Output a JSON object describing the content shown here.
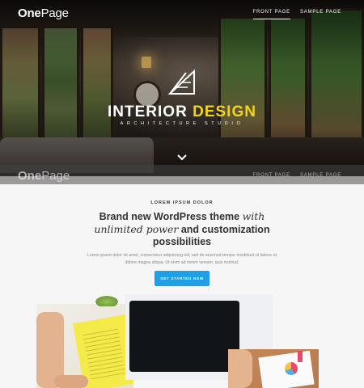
{
  "site": {
    "logo_bold": "One",
    "logo_light": "Page"
  },
  "nav": {
    "items": [
      {
        "label": "FRONT PAGE",
        "active": true
      },
      {
        "label": "SAMPLE PAGE",
        "active": false
      }
    ]
  },
  "hero": {
    "title_white": "INTERIOR ",
    "title_accent": "DESIGN",
    "subtitle": "ARCHITECTURE STUDIO",
    "accent_color": "#f5d319",
    "logo_icon": "triangle-ruler-icon",
    "scroll_icon": "chevron-down-icon"
  },
  "content": {
    "eyebrow": "LOREM IPSUM DOLOR",
    "headline_part1": "Brand new WordPress theme ",
    "headline_italic1": "with unlimited power",
    "headline_part2": " and customization possibilities",
    "body": "Lorem ipsum dolor sit amet, consectetur adipisicing elit, sed do eiusmod tempor incididunt ut labore et dolore magna aliqua. Ut enim ad minim veniam, quis nostrud.",
    "cta_label": "GET STARTED NOW",
    "cta_color": "#1e9fe6"
  },
  "showcase": {
    "images": [
      "magazine-photo",
      "desktop-monitor-photo",
      "desk-charts-photo"
    ]
  }
}
